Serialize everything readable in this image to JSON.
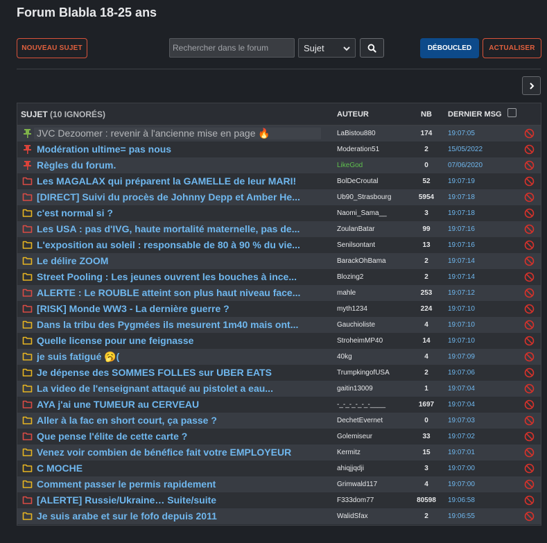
{
  "header": {
    "title": "Forum Blabla 18-25 ans",
    "new_topic_label": "NOUVEAU SUJET",
    "search_placeholder": "Rechercher dans le forum",
    "search_scope": "Sujet",
    "unblock_label": "DÉBOUCLED",
    "refresh_label": "ACTUALISER"
  },
  "table": {
    "col_subject": "SUJET",
    "col_ignored": "(10 IGNORÉS)",
    "col_author": "AUTEUR",
    "col_nb": "NB",
    "col_last": "DERNIER MSG"
  },
  "colors": {
    "pin_green": "#7fb24a",
    "pin_red": "#d9433a",
    "folder_red": "#d94b45",
    "folder_yellow": "#e6b422",
    "ban": "#d6322b",
    "link_blue": "#6fb7ee"
  },
  "topics": [
    {
      "icon": "pin-green",
      "subject": "JVC Dezoomer : revenir à l'ancienne mise en page 🔥",
      "author": "LaBistou880",
      "nb": "174",
      "last": "19:07:05",
      "muted": true
    },
    {
      "icon": "pin-red",
      "subject": "Modération ultime= pas nous",
      "author": "Moderation51",
      "nb": "2",
      "last": "15/05/2022"
    },
    {
      "icon": "pin-red",
      "subject": "Règles du forum.",
      "author": "LikeGod",
      "nb": "0",
      "last": "07/06/2020",
      "author_green": true
    },
    {
      "icon": "folder-red",
      "subject": "Les MAGALAX qui préparent la GAMELLE de leur MARI!",
      "author": "BolDeCroutal",
      "nb": "52",
      "last": "19:07:19"
    },
    {
      "icon": "folder-red",
      "subject": "[DIRECT] Suivi du procès de Johnny Depp et Amber He...",
      "author": "Ub90_Strasbourg",
      "nb": "5954",
      "last": "19:07:18"
    },
    {
      "icon": "folder-yellow",
      "subject": "c'est normal si ?",
      "author": "Naomi_Sama__",
      "nb": "3",
      "last": "19:07:18"
    },
    {
      "icon": "folder-red",
      "subject": "Les USA : pas d'IVG, haute mortalité maternelle, pas de...",
      "author": "ZoulanBatar",
      "nb": "99",
      "last": "19:07:16"
    },
    {
      "icon": "folder-yellow",
      "subject": "L'exposition au soleil : responsable de 80 à 90 % du vie...",
      "author": "Senilsontant",
      "nb": "13",
      "last": "19:07:16"
    },
    {
      "icon": "folder-yellow",
      "subject": "Le délire ZOOM",
      "author": "BarackOhBama",
      "nb": "2",
      "last": "19:07:14"
    },
    {
      "icon": "folder-yellow",
      "subject": "Street Pooling : Les jeunes ouvrent les bouches à ince...",
      "author": "Blozing2",
      "nb": "2",
      "last": "19:07:14"
    },
    {
      "icon": "folder-red",
      "subject": "ALERTE : Le ROUBLE atteint son plus haut niveau face...",
      "author": "mahle",
      "nb": "253",
      "last": "19:07:12"
    },
    {
      "icon": "folder-red",
      "subject": "[RISK] Monde WW3 - La dernière guerre ?",
      "author": "myth1234",
      "nb": "224",
      "last": "19:07:10"
    },
    {
      "icon": "folder-yellow",
      "subject": "Dans la tribu des Pygmées ils mesurent 1m40 mais ont...",
      "author": "Gauchioliste",
      "nb": "4",
      "last": "19:07:10"
    },
    {
      "icon": "folder-yellow",
      "subject": "Quelle license pour une feignasse",
      "author": "StroheimMP40",
      "nb": "14",
      "last": "19:07:10"
    },
    {
      "icon": "folder-yellow",
      "subject": "je suis fatigué 🥱(",
      "author": "40kg",
      "nb": "4",
      "last": "19:07:09"
    },
    {
      "icon": "folder-yellow",
      "subject": "Je dépense des SOMMES FOLLES sur UBER EATS",
      "author": "TrumpkingofUSA",
      "nb": "2",
      "last": "19:07:06"
    },
    {
      "icon": "folder-yellow",
      "subject": "La video de l'enseignant attaqué au pistolet a eau...",
      "author": "gaitin13009",
      "nb": "1",
      "last": "19:07:04"
    },
    {
      "icon": "folder-red",
      "subject": "AYA j'ai une TUMEUR au CERVEAU",
      "author": "-_-_-_-_-_-____",
      "nb": "1697",
      "last": "19:07:04"
    },
    {
      "icon": "folder-yellow",
      "subject": "Aller à la fac en short court, ça passe ?",
      "author": "DechetEvernet",
      "nb": "0",
      "last": "19:07:03"
    },
    {
      "icon": "folder-red",
      "subject": "Que pense l'élite de cette carte ?",
      "author": "Golemiseur",
      "nb": "33",
      "last": "19:07:02"
    },
    {
      "icon": "folder-yellow",
      "subject": "Venez voir combien de bénéfice fait votre EMPLOYEUR",
      "author": "Kermitz",
      "nb": "15",
      "last": "19:07:01"
    },
    {
      "icon": "folder-yellow",
      "subject": "C MOCHE",
      "author": "ahiqjjqdji",
      "nb": "3",
      "last": "19:07:00"
    },
    {
      "icon": "folder-yellow",
      "subject": "Comment passer le permis rapidement",
      "author": "Grimwald117",
      "nb": "4",
      "last": "19:07:00"
    },
    {
      "icon": "folder-red",
      "subject": "[ALERTE] Russie/Ukraine… Suite/suite",
      "author": "F333dom77",
      "nb": "80598",
      "last": "19:06:58"
    },
    {
      "icon": "folder-yellow",
      "subject": "Je suis arabe et sur le fofo depuis 2011",
      "author": "WalidSfax",
      "nb": "2",
      "last": "19:06:55"
    }
  ]
}
